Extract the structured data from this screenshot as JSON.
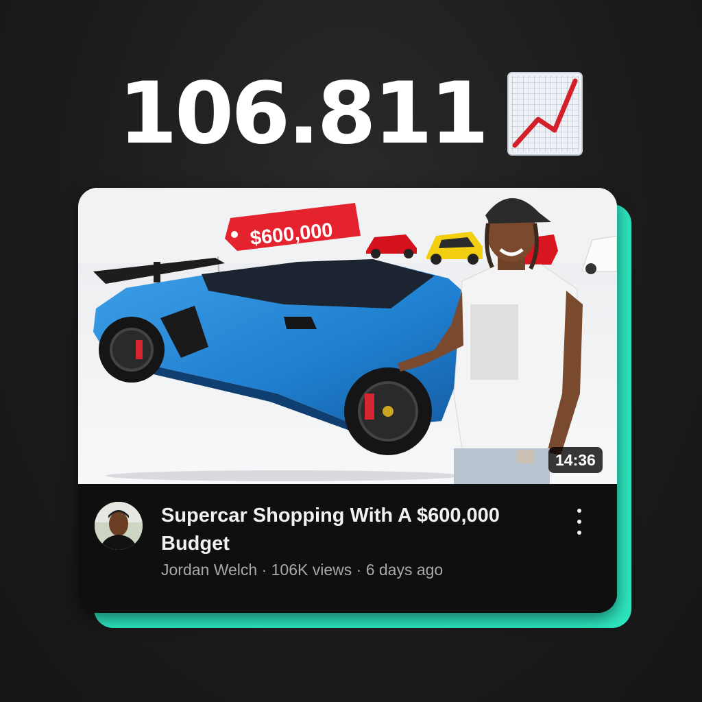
{
  "headline": {
    "count": "106.811",
    "icon": "chart-increasing-icon"
  },
  "accent_color": "#2ee6c0",
  "video": {
    "thumbnail_price_tag": "$600,000",
    "duration": "14:36",
    "title": "Supercar Shopping With A $600,000 Budget",
    "channel": "Jordan Welch",
    "views": "106K views",
    "age": "6 days ago",
    "meta": "Jordan Welch · 106K views · 6 days ago"
  }
}
